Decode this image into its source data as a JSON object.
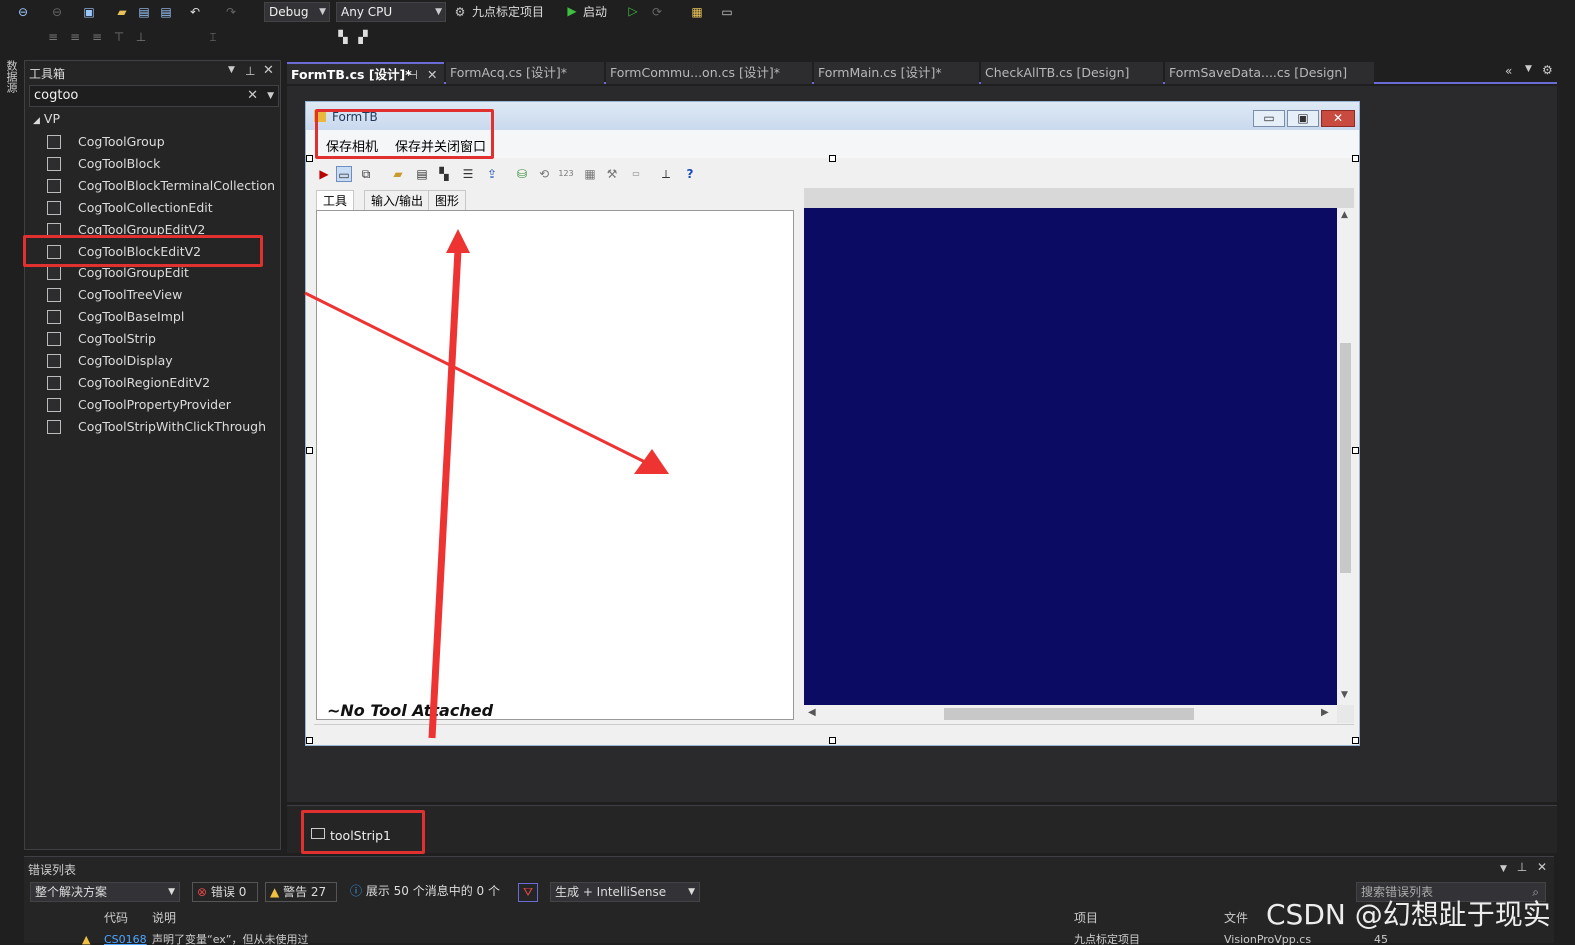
{
  "toolbar": {
    "config": "Debug",
    "platform": "Any CPU",
    "startup_project": "九点标定项目",
    "run_label": "启动"
  },
  "left_strip": {
    "label": "数据源"
  },
  "toolbox": {
    "title": "工具箱",
    "search_value": "cogtoo",
    "group": "VP",
    "items": [
      {
        "label": "CogToolGroup"
      },
      {
        "label": "CogToolBlock"
      },
      {
        "label": "CogToolBlockTerminalCollection"
      },
      {
        "label": "CogToolCollectionEdit"
      },
      {
        "label": "CogToolGroupEditV2"
      },
      {
        "label": "CogToolBlockEditV2"
      },
      {
        "label": "CogToolGroupEdit"
      },
      {
        "label": "CogToolTreeView"
      },
      {
        "label": "CogToolBaseImpl"
      },
      {
        "label": "CogToolStrip"
      },
      {
        "label": "CogToolDisplay"
      },
      {
        "label": "CogToolRegionEditV2"
      },
      {
        "label": "CogToolPropertyProvider"
      },
      {
        "label": "CogToolStripWithClickThrough"
      }
    ]
  },
  "tabs": [
    {
      "label": "FormTB.cs [设计]*"
    },
    {
      "label": "FormAcq.cs [设计]*"
    },
    {
      "label": "FormCommu...on.cs [设计]*"
    },
    {
      "label": "FormMain.cs [设计]*"
    },
    {
      "label": "CheckAllTB.cs [Design]"
    },
    {
      "label": "FormSaveData....cs [Design]"
    }
  ],
  "form": {
    "title": "FormTB",
    "menu": [
      "保存相机",
      "保存并关闭窗口"
    ],
    "panel_tabs": [
      "工具",
      "输入/输出",
      "图形"
    ],
    "no_tool": "~No Tool Attached"
  },
  "component_tray": {
    "item": "toolStrip1"
  },
  "error_list": {
    "title": "错误列表",
    "scope": "整个解决方案",
    "errors": "错误 0",
    "warnings": "警告 27",
    "messages": "展示 50 个消息中的 0 个",
    "build_filter": "生成 + IntelliSense",
    "search_placeholder": "搜索错误列表",
    "columns": [
      "代码",
      "说明",
      "项目",
      "文件"
    ],
    "row": {
      "code": "CS0168",
      "desc": "声明了变量“ex”，但从未使用过",
      "project": "九点标定项目",
      "file": "VisionProVpp.cs",
      "line": "45"
    }
  },
  "watermark": "CSDN @幻想趾于现实",
  "colors": {
    "accent": "#6b6bd6",
    "highlight": "#e03030",
    "display_bg": "#0b0b63",
    "arrow": "#ee3333"
  }
}
